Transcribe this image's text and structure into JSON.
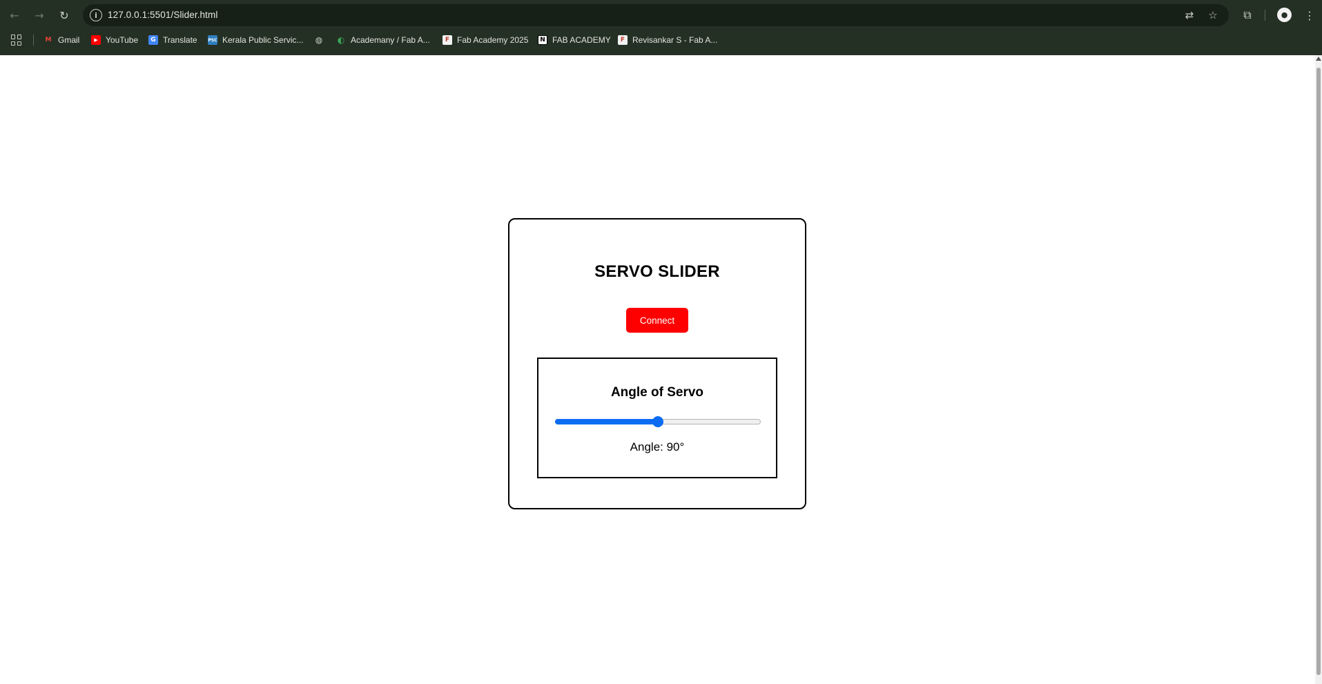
{
  "browser": {
    "url": "127.0.0.1:5501/Slider.html",
    "nav": {
      "back": "back-arrow-icon",
      "forward": "forward-arrow-icon",
      "reload": "reload-icon"
    },
    "bookmarks": [
      {
        "label": "Gmail",
        "icon": "gmail-icon"
      },
      {
        "label": "YouTube",
        "icon": "youtube-icon"
      },
      {
        "label": "Translate",
        "icon": "translate-icon"
      },
      {
        "label": "Kerala Public Servic...",
        "icon": "psc-icon"
      },
      {
        "label": "",
        "icon": "globe-icon"
      },
      {
        "label": "Academany / Fab A...",
        "icon": "academany-icon"
      },
      {
        "label": "Fab Academy 2025",
        "icon": "fab-academy-icon"
      },
      {
        "label": "FAB ACADEMY",
        "icon": "notion-icon"
      },
      {
        "label": "Revisankar S - Fab A...",
        "icon": "fab-academy-icon"
      }
    ]
  },
  "app": {
    "title": "SERVO SLIDER",
    "connect_label": "Connect",
    "panel": {
      "title": "Angle of Servo",
      "slider": {
        "min": 0,
        "max": 180,
        "value": 90
      },
      "angle_text": "Angle: 90°"
    }
  },
  "colors": {
    "chrome_bg": "#253024",
    "connect_bg": "#ff0000",
    "slider_accent": "#0b6cf2"
  }
}
